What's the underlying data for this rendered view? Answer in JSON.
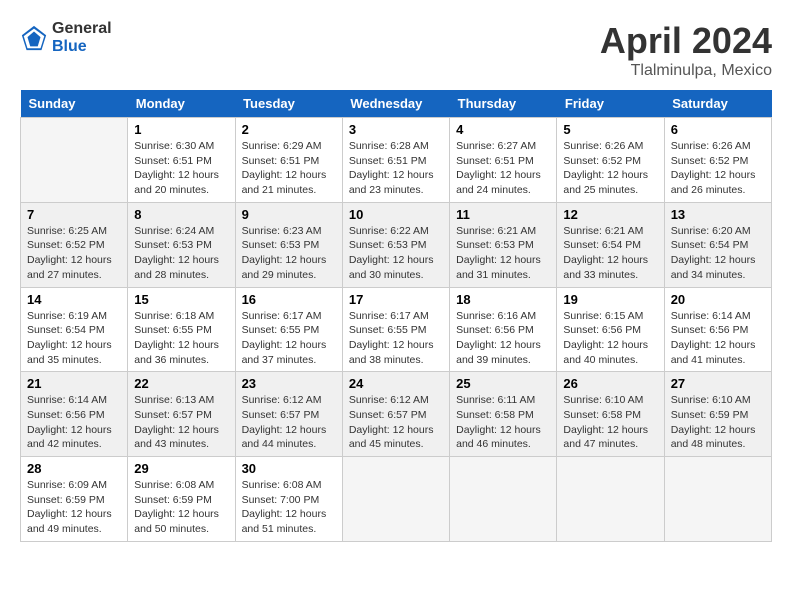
{
  "header": {
    "logo": {
      "general": "General",
      "blue": "Blue"
    },
    "title": "April 2024",
    "location": "Tlalminulpa, Mexico"
  },
  "days_of_week": [
    "Sunday",
    "Monday",
    "Tuesday",
    "Wednesday",
    "Thursday",
    "Friday",
    "Saturday"
  ],
  "weeks": [
    [
      {
        "day": "",
        "info": ""
      },
      {
        "day": "1",
        "info": "Sunrise: 6:30 AM\nSunset: 6:51 PM\nDaylight: 12 hours\nand 20 minutes."
      },
      {
        "day": "2",
        "info": "Sunrise: 6:29 AM\nSunset: 6:51 PM\nDaylight: 12 hours\nand 21 minutes."
      },
      {
        "day": "3",
        "info": "Sunrise: 6:28 AM\nSunset: 6:51 PM\nDaylight: 12 hours\nand 23 minutes."
      },
      {
        "day": "4",
        "info": "Sunrise: 6:27 AM\nSunset: 6:51 PM\nDaylight: 12 hours\nand 24 minutes."
      },
      {
        "day": "5",
        "info": "Sunrise: 6:26 AM\nSunset: 6:52 PM\nDaylight: 12 hours\nand 25 minutes."
      },
      {
        "day": "6",
        "info": "Sunrise: 6:26 AM\nSunset: 6:52 PM\nDaylight: 12 hours\nand 26 minutes."
      }
    ],
    [
      {
        "day": "7",
        "info": "Sunrise: 6:25 AM\nSunset: 6:52 PM\nDaylight: 12 hours\nand 27 minutes."
      },
      {
        "day": "8",
        "info": "Sunrise: 6:24 AM\nSunset: 6:53 PM\nDaylight: 12 hours\nand 28 minutes."
      },
      {
        "day": "9",
        "info": "Sunrise: 6:23 AM\nSunset: 6:53 PM\nDaylight: 12 hours\nand 29 minutes."
      },
      {
        "day": "10",
        "info": "Sunrise: 6:22 AM\nSunset: 6:53 PM\nDaylight: 12 hours\nand 30 minutes."
      },
      {
        "day": "11",
        "info": "Sunrise: 6:21 AM\nSunset: 6:53 PM\nDaylight: 12 hours\nand 31 minutes."
      },
      {
        "day": "12",
        "info": "Sunrise: 6:21 AM\nSunset: 6:54 PM\nDaylight: 12 hours\nand 33 minutes."
      },
      {
        "day": "13",
        "info": "Sunrise: 6:20 AM\nSunset: 6:54 PM\nDaylight: 12 hours\nand 34 minutes."
      }
    ],
    [
      {
        "day": "14",
        "info": "Sunrise: 6:19 AM\nSunset: 6:54 PM\nDaylight: 12 hours\nand 35 minutes."
      },
      {
        "day": "15",
        "info": "Sunrise: 6:18 AM\nSunset: 6:55 PM\nDaylight: 12 hours\nand 36 minutes."
      },
      {
        "day": "16",
        "info": "Sunrise: 6:17 AM\nSunset: 6:55 PM\nDaylight: 12 hours\nand 37 minutes."
      },
      {
        "day": "17",
        "info": "Sunrise: 6:17 AM\nSunset: 6:55 PM\nDaylight: 12 hours\nand 38 minutes."
      },
      {
        "day": "18",
        "info": "Sunrise: 6:16 AM\nSunset: 6:56 PM\nDaylight: 12 hours\nand 39 minutes."
      },
      {
        "day": "19",
        "info": "Sunrise: 6:15 AM\nSunset: 6:56 PM\nDaylight: 12 hours\nand 40 minutes."
      },
      {
        "day": "20",
        "info": "Sunrise: 6:14 AM\nSunset: 6:56 PM\nDaylight: 12 hours\nand 41 minutes."
      }
    ],
    [
      {
        "day": "21",
        "info": "Sunrise: 6:14 AM\nSunset: 6:56 PM\nDaylight: 12 hours\nand 42 minutes."
      },
      {
        "day": "22",
        "info": "Sunrise: 6:13 AM\nSunset: 6:57 PM\nDaylight: 12 hours\nand 43 minutes."
      },
      {
        "day": "23",
        "info": "Sunrise: 6:12 AM\nSunset: 6:57 PM\nDaylight: 12 hours\nand 44 minutes."
      },
      {
        "day": "24",
        "info": "Sunrise: 6:12 AM\nSunset: 6:57 PM\nDaylight: 12 hours\nand 45 minutes."
      },
      {
        "day": "25",
        "info": "Sunrise: 6:11 AM\nSunset: 6:58 PM\nDaylight: 12 hours\nand 46 minutes."
      },
      {
        "day": "26",
        "info": "Sunrise: 6:10 AM\nSunset: 6:58 PM\nDaylight: 12 hours\nand 47 minutes."
      },
      {
        "day": "27",
        "info": "Sunrise: 6:10 AM\nSunset: 6:59 PM\nDaylight: 12 hours\nand 48 minutes."
      }
    ],
    [
      {
        "day": "28",
        "info": "Sunrise: 6:09 AM\nSunset: 6:59 PM\nDaylight: 12 hours\nand 49 minutes."
      },
      {
        "day": "29",
        "info": "Sunrise: 6:08 AM\nSunset: 6:59 PM\nDaylight: 12 hours\nand 50 minutes."
      },
      {
        "day": "30",
        "info": "Sunrise: 6:08 AM\nSunset: 7:00 PM\nDaylight: 12 hours\nand 51 minutes."
      },
      {
        "day": "",
        "info": ""
      },
      {
        "day": "",
        "info": ""
      },
      {
        "day": "",
        "info": ""
      },
      {
        "day": "",
        "info": ""
      }
    ]
  ]
}
